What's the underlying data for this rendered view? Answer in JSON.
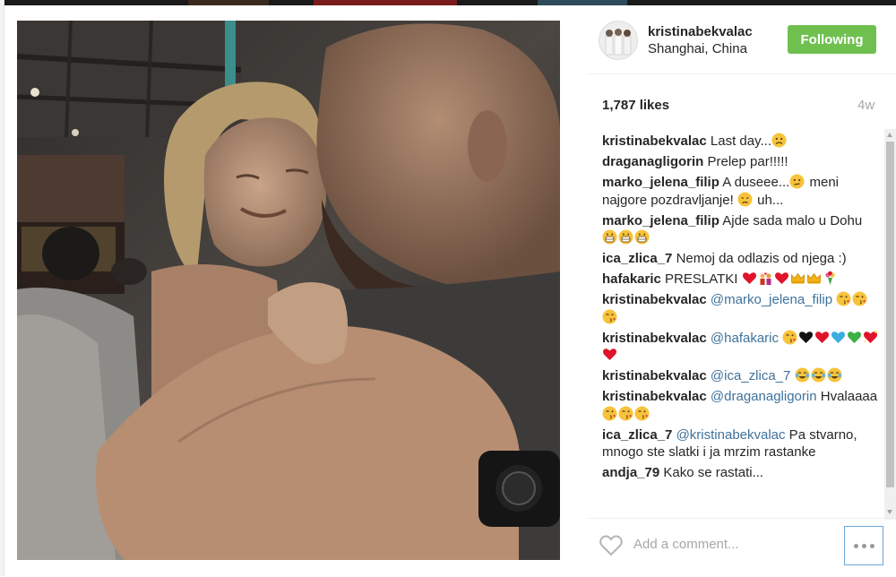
{
  "post": {
    "author": "kristinabekvalac",
    "location": "Shanghai, China",
    "follow_label": "Following",
    "likes": "1,787 likes",
    "age": "4w",
    "add_comment_placeholder": "Add a comment..."
  },
  "comments": [
    {
      "user": "kristinabekvalac",
      "text": " Last day...",
      "emojis": [
        "sad-face"
      ]
    },
    {
      "user": "draganagligorin",
      "text": " Prelep par!!!!!",
      "emojis": []
    },
    {
      "user": "marko_jelena_filip",
      "text": " A duseee...",
      "emojis": [
        "confused-face"
      ],
      "text2": " meni najgore pozdravljanje! ",
      "emojis2": [
        "worried-face"
      ],
      "text3": " uh..."
    },
    {
      "user": "marko_jelena_filip",
      "text": " Ajde sada malo u Dohu ",
      "emojis": [
        "scream-face",
        "scream-face",
        "scream-face"
      ]
    },
    {
      "user": "ica_zlica_7",
      "text": " Nemoj da odlazis od njega :)",
      "emojis": []
    },
    {
      "user": "hafakaric",
      "text": " PRESLATKI ",
      "emojis": [
        "red-heart",
        "couple-heart",
        "red-heart",
        "crown",
        "crown",
        "bouquet"
      ]
    },
    {
      "user": "kristinabekvalac",
      "mention": " @marko_jelena_filip",
      "text": " ",
      "emojis": [
        "kiss-face",
        "kiss-face",
        "kiss-face"
      ]
    },
    {
      "user": "kristinabekvalac",
      "mention": " @hafakaric",
      "text": " ",
      "emojis": [
        "kiss-face",
        "black-heart",
        "red-heart",
        "blue-heart",
        "green-heart",
        "sparkling-heart",
        "red-heart"
      ]
    },
    {
      "user": "kristinabekvalac",
      "mention": " @ica_zlica_7",
      "text": " ",
      "emojis": [
        "joy-face",
        "joy-face",
        "joy-face"
      ]
    },
    {
      "user": "kristinabekvalac",
      "mention": " @draganagligorin",
      "text": " Hvalaaaa",
      "emojis": [
        "kiss-face",
        "kiss-face",
        "kiss-face"
      ]
    },
    {
      "user": "ica_zlica_7",
      "mention": " @kristinabekvalac",
      "text": " Pa stvarno, mnogo ste slatki i ja mrzim rastanke",
      "emojis": []
    },
    {
      "user": "andja_79",
      "text": " Kako se rastati...",
      "emojis": []
    }
  ],
  "icons": {
    "heart": "heart-outline-icon",
    "more": "more-options-icon"
  },
  "colors": {
    "follow_bg": "#70c050",
    "mention": "#3f729b",
    "muted": "#a5a7aa"
  }
}
